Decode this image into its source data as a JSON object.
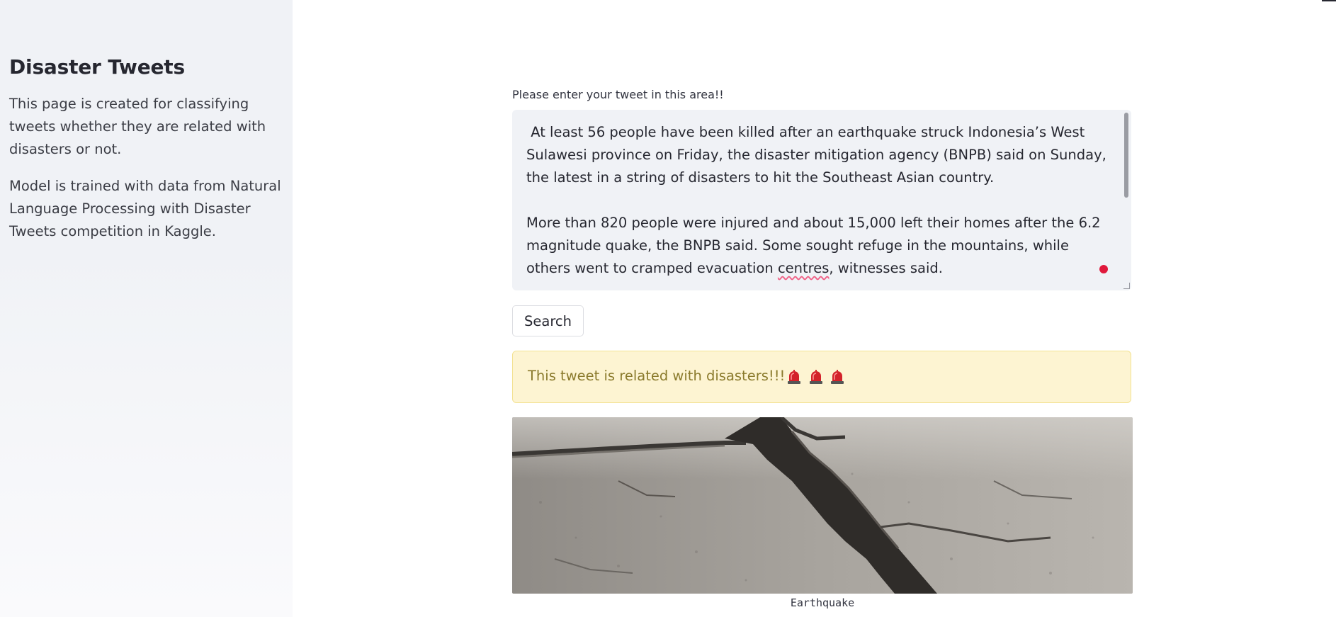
{
  "sidebar": {
    "title": "Disaster Tweets",
    "paragraphs": [
      "This page is created for classifying tweets whether they are related with disasters or not.",
      "Model is trained with data from Natural Language Processing with Disaster Tweets competition in Kaggle."
    ]
  },
  "main": {
    "input_label": "Please enter your tweet in this area!!",
    "tweet": {
      "line1": " At least 56 people have been killed after an earthquake struck Indonesia’s West Sulawesi province on Friday, the disaster mitigation agency (BNPB) said on Sunday, the latest in a string of disasters to hit the Southeast Asian country.",
      "line2_before": "More than 820 people were injured and about 15,000 left their homes after the 6.2 magnitude quake, the BNPB said. Some sought refuge in the mountains, while others went to cramped evacuation ",
      "line2_misspelled": "centres",
      "line2_after": ", witnesses said."
    },
    "search_label": "Search",
    "result": {
      "text": "This tweet is related with disasters!!!",
      "icon": "siren-icon",
      "icon_count": 3
    },
    "image": {
      "subject": "cracked-ground",
      "caption": "Earthquake"
    }
  }
}
